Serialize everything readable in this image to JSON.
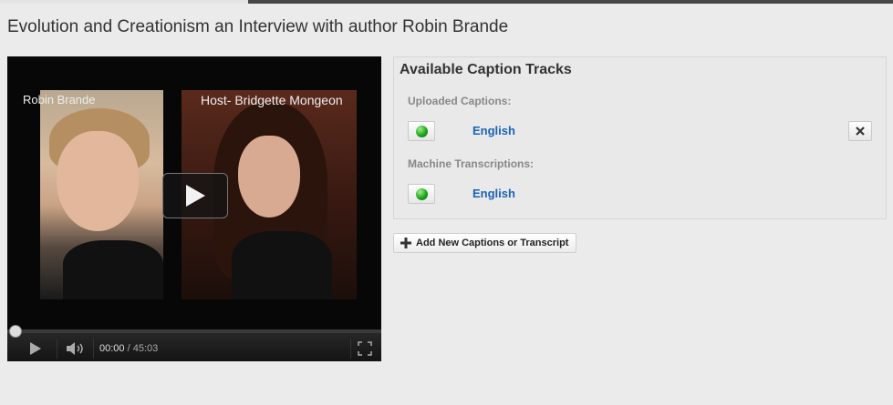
{
  "video": {
    "title": "Evolution and Creationism an Interview with author Robin Brande",
    "overlay_left": "Robin Brande",
    "overlay_right": "Host- Bridgette Mongeon",
    "current_time": "00:00",
    "total_time": "/ 45:03",
    "progress": 0
  },
  "captions": {
    "title": "Available Caption Tracks",
    "uploaded_label": "Uploaded Captions:",
    "uploaded_track": "English",
    "machine_label": "Machine Transcriptions:",
    "machine_track": "English",
    "add_button": "Add New Captions or Transcript"
  },
  "icons": {
    "play_big": "play-icon",
    "play": "play-icon",
    "volume": "volume-icon",
    "fullscreen": "fullscreen-icon",
    "status": "green-status-icon",
    "remove": "close-icon",
    "add": "plus-icon"
  }
}
